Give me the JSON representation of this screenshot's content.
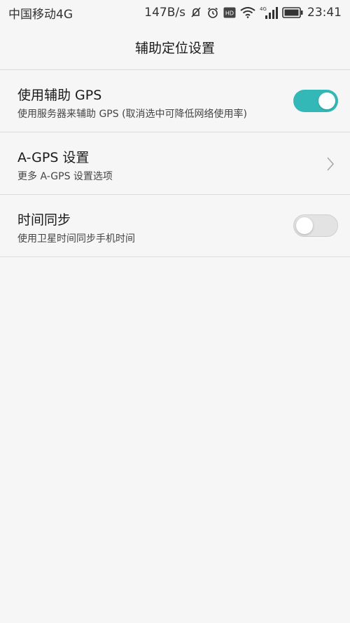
{
  "status_bar": {
    "carrier": "中国移动4G",
    "speed": "147B/s",
    "network_badge": "4G",
    "hd_badge": "HD",
    "time": "23:41",
    "icons": [
      "mute-icon",
      "alarm-icon",
      "hd-icon",
      "wifi-icon",
      "signal-icon",
      "battery-icon"
    ]
  },
  "header": {
    "title": "辅助定位设置"
  },
  "settings": [
    {
      "title": "使用辅助 GPS",
      "subtitle": "使用服务器来辅助 GPS (取消选中可降低网络使用率)",
      "control": "toggle",
      "checked": true
    },
    {
      "title": "A-GPS 设置",
      "subtitle": "更多 A-GPS 设置选项",
      "control": "chevron"
    },
    {
      "title": "时间同步",
      "subtitle": "使用卫星时间同步手机时间",
      "control": "toggle",
      "checked": false
    }
  ],
  "colors": {
    "accent": "#34b8b7",
    "background": "#f6f6f6",
    "divider": "#dcdcdc",
    "toggle_off": "#e3e3e3"
  }
}
